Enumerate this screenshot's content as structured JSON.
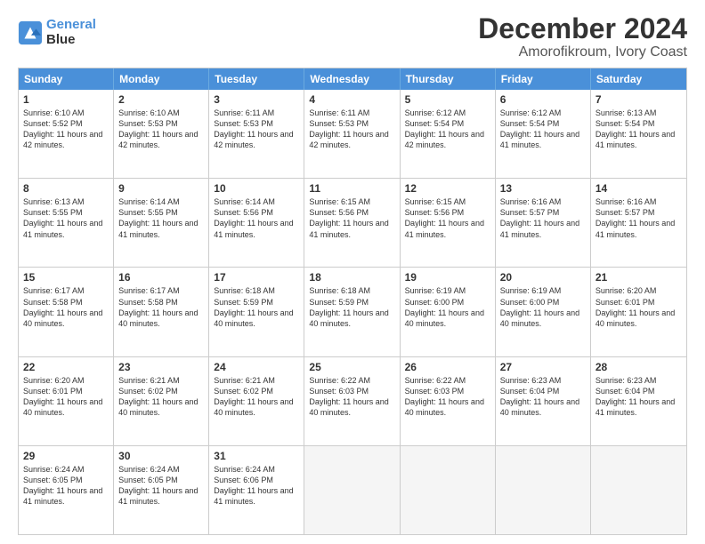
{
  "header": {
    "logo_line1": "General",
    "logo_line2": "Blue",
    "title": "December 2024",
    "subtitle": "Amorofikroum, Ivory Coast"
  },
  "days": [
    "Sunday",
    "Monday",
    "Tuesday",
    "Wednesday",
    "Thursday",
    "Friday",
    "Saturday"
  ],
  "weeks": [
    [
      {
        "date": "1",
        "sunrise": "6:10 AM",
        "sunset": "5:52 PM",
        "daylight": "11 hours and 42 minutes."
      },
      {
        "date": "2",
        "sunrise": "6:10 AM",
        "sunset": "5:53 PM",
        "daylight": "11 hours and 42 minutes."
      },
      {
        "date": "3",
        "sunrise": "6:11 AM",
        "sunset": "5:53 PM",
        "daylight": "11 hours and 42 minutes."
      },
      {
        "date": "4",
        "sunrise": "6:11 AM",
        "sunset": "5:53 PM",
        "daylight": "11 hours and 42 minutes."
      },
      {
        "date": "5",
        "sunrise": "6:12 AM",
        "sunset": "5:54 PM",
        "daylight": "11 hours and 42 minutes."
      },
      {
        "date": "6",
        "sunrise": "6:12 AM",
        "sunset": "5:54 PM",
        "daylight": "11 hours and 41 minutes."
      },
      {
        "date": "7",
        "sunrise": "6:13 AM",
        "sunset": "5:54 PM",
        "daylight": "11 hours and 41 minutes."
      }
    ],
    [
      {
        "date": "8",
        "sunrise": "6:13 AM",
        "sunset": "5:55 PM",
        "daylight": "11 hours and 41 minutes."
      },
      {
        "date": "9",
        "sunrise": "6:14 AM",
        "sunset": "5:55 PM",
        "daylight": "11 hours and 41 minutes."
      },
      {
        "date": "10",
        "sunrise": "6:14 AM",
        "sunset": "5:56 PM",
        "daylight": "11 hours and 41 minutes."
      },
      {
        "date": "11",
        "sunrise": "6:15 AM",
        "sunset": "5:56 PM",
        "daylight": "11 hours and 41 minutes."
      },
      {
        "date": "12",
        "sunrise": "6:15 AM",
        "sunset": "5:56 PM",
        "daylight": "11 hours and 41 minutes."
      },
      {
        "date": "13",
        "sunrise": "6:16 AM",
        "sunset": "5:57 PM",
        "daylight": "11 hours and 41 minutes."
      },
      {
        "date": "14",
        "sunrise": "6:16 AM",
        "sunset": "5:57 PM",
        "daylight": "11 hours and 41 minutes."
      }
    ],
    [
      {
        "date": "15",
        "sunrise": "6:17 AM",
        "sunset": "5:58 PM",
        "daylight": "11 hours and 40 minutes."
      },
      {
        "date": "16",
        "sunrise": "6:17 AM",
        "sunset": "5:58 PM",
        "daylight": "11 hours and 40 minutes."
      },
      {
        "date": "17",
        "sunrise": "6:18 AM",
        "sunset": "5:59 PM",
        "daylight": "11 hours and 40 minutes."
      },
      {
        "date": "18",
        "sunrise": "6:18 AM",
        "sunset": "5:59 PM",
        "daylight": "11 hours and 40 minutes."
      },
      {
        "date": "19",
        "sunrise": "6:19 AM",
        "sunset": "6:00 PM",
        "daylight": "11 hours and 40 minutes."
      },
      {
        "date": "20",
        "sunrise": "6:19 AM",
        "sunset": "6:00 PM",
        "daylight": "11 hours and 40 minutes."
      },
      {
        "date": "21",
        "sunrise": "6:20 AM",
        "sunset": "6:01 PM",
        "daylight": "11 hours and 40 minutes."
      }
    ],
    [
      {
        "date": "22",
        "sunrise": "6:20 AM",
        "sunset": "6:01 PM",
        "daylight": "11 hours and 40 minutes."
      },
      {
        "date": "23",
        "sunrise": "6:21 AM",
        "sunset": "6:02 PM",
        "daylight": "11 hours and 40 minutes."
      },
      {
        "date": "24",
        "sunrise": "6:21 AM",
        "sunset": "6:02 PM",
        "daylight": "11 hours and 40 minutes."
      },
      {
        "date": "25",
        "sunrise": "6:22 AM",
        "sunset": "6:03 PM",
        "daylight": "11 hours and 40 minutes."
      },
      {
        "date": "26",
        "sunrise": "6:22 AM",
        "sunset": "6:03 PM",
        "daylight": "11 hours and 40 minutes."
      },
      {
        "date": "27",
        "sunrise": "6:23 AM",
        "sunset": "6:04 PM",
        "daylight": "11 hours and 40 minutes."
      },
      {
        "date": "28",
        "sunrise": "6:23 AM",
        "sunset": "6:04 PM",
        "daylight": "11 hours and 41 minutes."
      }
    ],
    [
      {
        "date": "29",
        "sunrise": "6:24 AM",
        "sunset": "6:05 PM",
        "daylight": "11 hours and 41 minutes."
      },
      {
        "date": "30",
        "sunrise": "6:24 AM",
        "sunset": "6:05 PM",
        "daylight": "11 hours and 41 minutes."
      },
      {
        "date": "31",
        "sunrise": "6:24 AM",
        "sunset": "6:06 PM",
        "daylight": "11 hours and 41 minutes."
      },
      null,
      null,
      null,
      null
    ]
  ]
}
